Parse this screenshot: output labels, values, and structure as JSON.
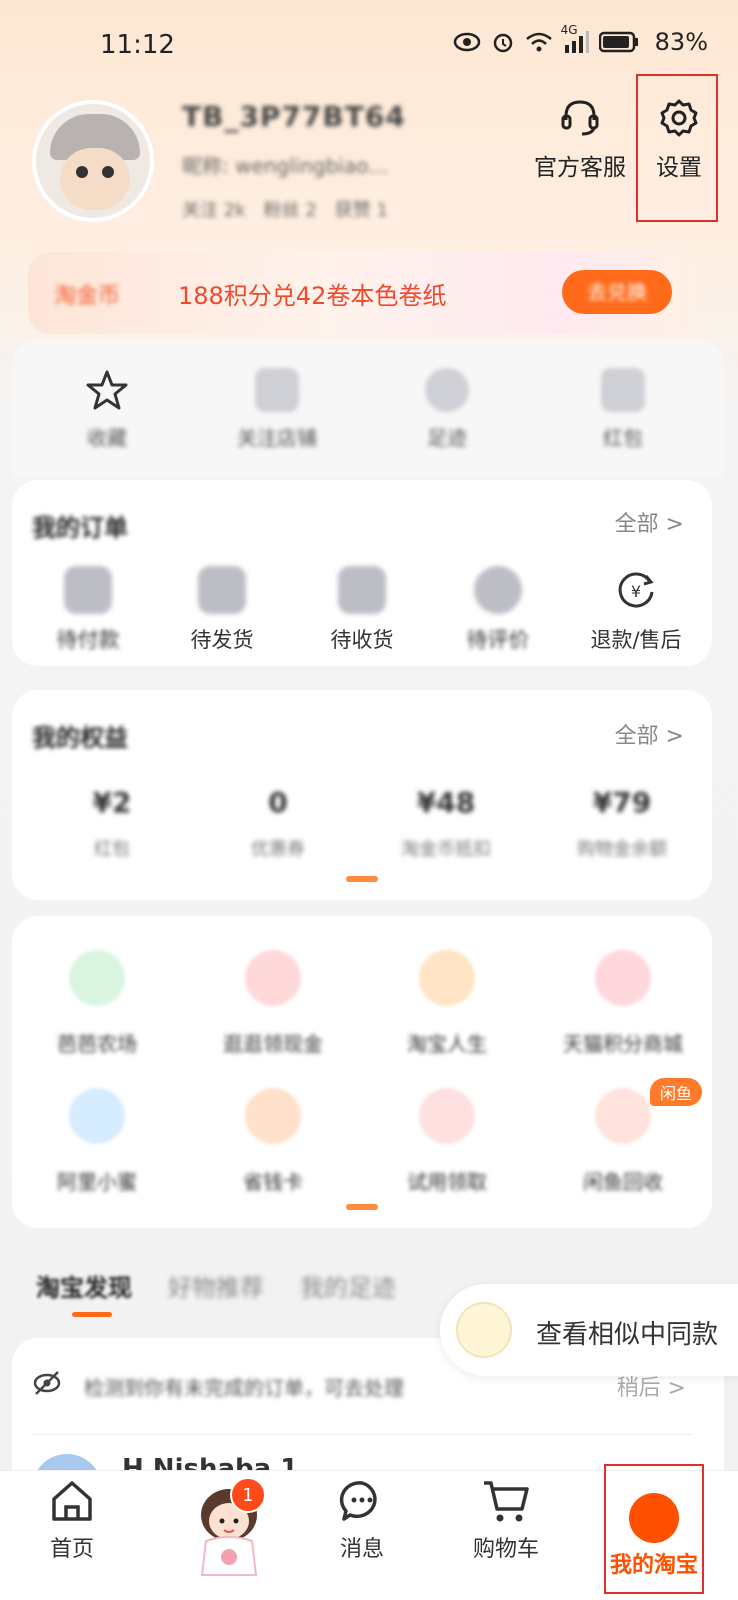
{
  "status_bar": {
    "time": "11:12",
    "network": "4G",
    "battery_pct": "83%"
  },
  "profile": {
    "username": "TB_3P77BT64",
    "subline": "昵称: wenglingbiao…",
    "stats": [
      "关注 2k",
      "粉丝 2",
      "获赞 1"
    ],
    "service_label": "官方客服",
    "settings_label": "设置"
  },
  "banner": {
    "prefix": "淘金币",
    "text": "188积分兑42卷本色卷纸",
    "button": "去兑换"
  },
  "quick_links": [
    "收藏",
    "关注店铺",
    "足迹",
    "红包"
  ],
  "orders": {
    "title": "我的订单",
    "see_all": "全部 >",
    "items": [
      "待付款",
      "待发货",
      "待收货",
      "待评价",
      "退款/售后"
    ]
  },
  "assets": {
    "title": "我的权益",
    "see_all": "全部 >",
    "items": [
      {
        "value": "¥2",
        "label": "红包"
      },
      {
        "value": "0",
        "label": "优惠券"
      },
      {
        "value": "¥48",
        "label": "淘金币抵扣"
      },
      {
        "value": "¥79",
        "label": "购物金余额"
      }
    ]
  },
  "services": {
    "items": [
      "芭芭农场",
      "逛逛领现金",
      "淘宝人生",
      "天猫积分商城",
      "阿里小蜜",
      "省钱卡",
      "试用领取",
      "闲鱼回收"
    ],
    "tag": "闲鱼"
  },
  "tabs": [
    "淘宝发现",
    "好物推荐",
    "我的足迹"
  ],
  "float_pill": "查看相似中同款",
  "feed": {
    "notice": "检测到你有未完成的订单，可去处理",
    "later": "稍后 >",
    "user": "H Nishaba 1"
  },
  "bottom_nav": {
    "home": "首页",
    "badge": "1",
    "messages": "消息",
    "cart": "购物车",
    "me": "我的淘宝"
  },
  "colors": {
    "accent": "#ff5000",
    "highlight_box": "#e0302b"
  }
}
